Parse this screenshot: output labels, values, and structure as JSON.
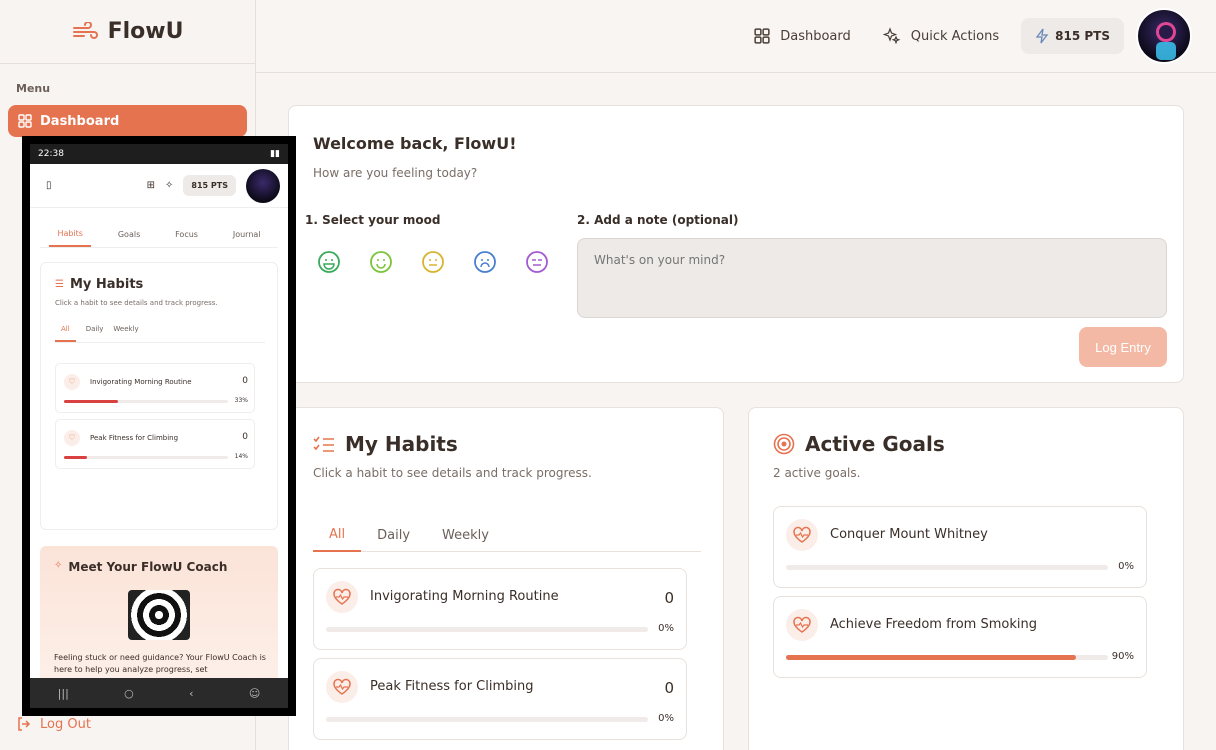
{
  "brand": {
    "name": "FlowU"
  },
  "sidebar": {
    "menu_label": "Menu",
    "active_item": "Dashboard",
    "logout_label": "Log Out"
  },
  "header": {
    "dashboard_label": "Dashboard",
    "quick_actions_label": "Quick Actions",
    "points_label": "815 PTS"
  },
  "welcome": {
    "title": "Welcome back, FlowU!",
    "subtitle": "How are you feeling today?",
    "step1": "1. Select your mood",
    "step2": "2. Add a note (optional)",
    "note_placeholder": "What's on your mind?",
    "log_button": "Log Entry",
    "moods": [
      "very-happy",
      "happy",
      "neutral",
      "sad",
      "meh"
    ]
  },
  "habits": {
    "title": "My Habits",
    "subtitle": "Click a habit to see details and track progress.",
    "tabs": [
      "All",
      "Daily",
      "Weekly"
    ],
    "items": [
      {
        "name": "Invigorating Morning Routine",
        "count": "0",
        "progress": 0,
        "progress_label": "0%"
      },
      {
        "name": "Peak Fitness for Climbing",
        "count": "0",
        "progress": 0,
        "progress_label": "0%"
      }
    ]
  },
  "goals": {
    "title": "Active Goals",
    "subtitle": "2 active goals.",
    "items": [
      {
        "name": "Conquer Mount Whitney",
        "progress": 0,
        "progress_label": "0%"
      },
      {
        "name": "Achieve Freedom from Smoking",
        "progress": 90,
        "progress_label": "90%"
      }
    ]
  },
  "phone": {
    "status_time": "22:38",
    "points_label": "815 PTS",
    "tabs": [
      "Habits",
      "Goals",
      "Focus",
      "Journal"
    ],
    "habits_title": "My Habits",
    "habits_subtitle": "Click a habit to see details and track progress.",
    "filter_tabs": [
      "All",
      "Daily",
      "Weekly"
    ],
    "items": [
      {
        "name": "Invigorating Morning Routine",
        "count": "0",
        "progress": 33,
        "progress_label": "33%"
      },
      {
        "name": "Peak Fitness for Climbing",
        "count": "0",
        "progress": 14,
        "progress_label": "14%"
      }
    ],
    "coach_title": "Meet Your FlowU Coach",
    "coach_text": "Feeling stuck or need guidance? Your FlowU Coach is here to help you analyze progress, set"
  },
  "colors": {
    "accent": "#e5734f",
    "accent_light": "#f3b9a4"
  }
}
